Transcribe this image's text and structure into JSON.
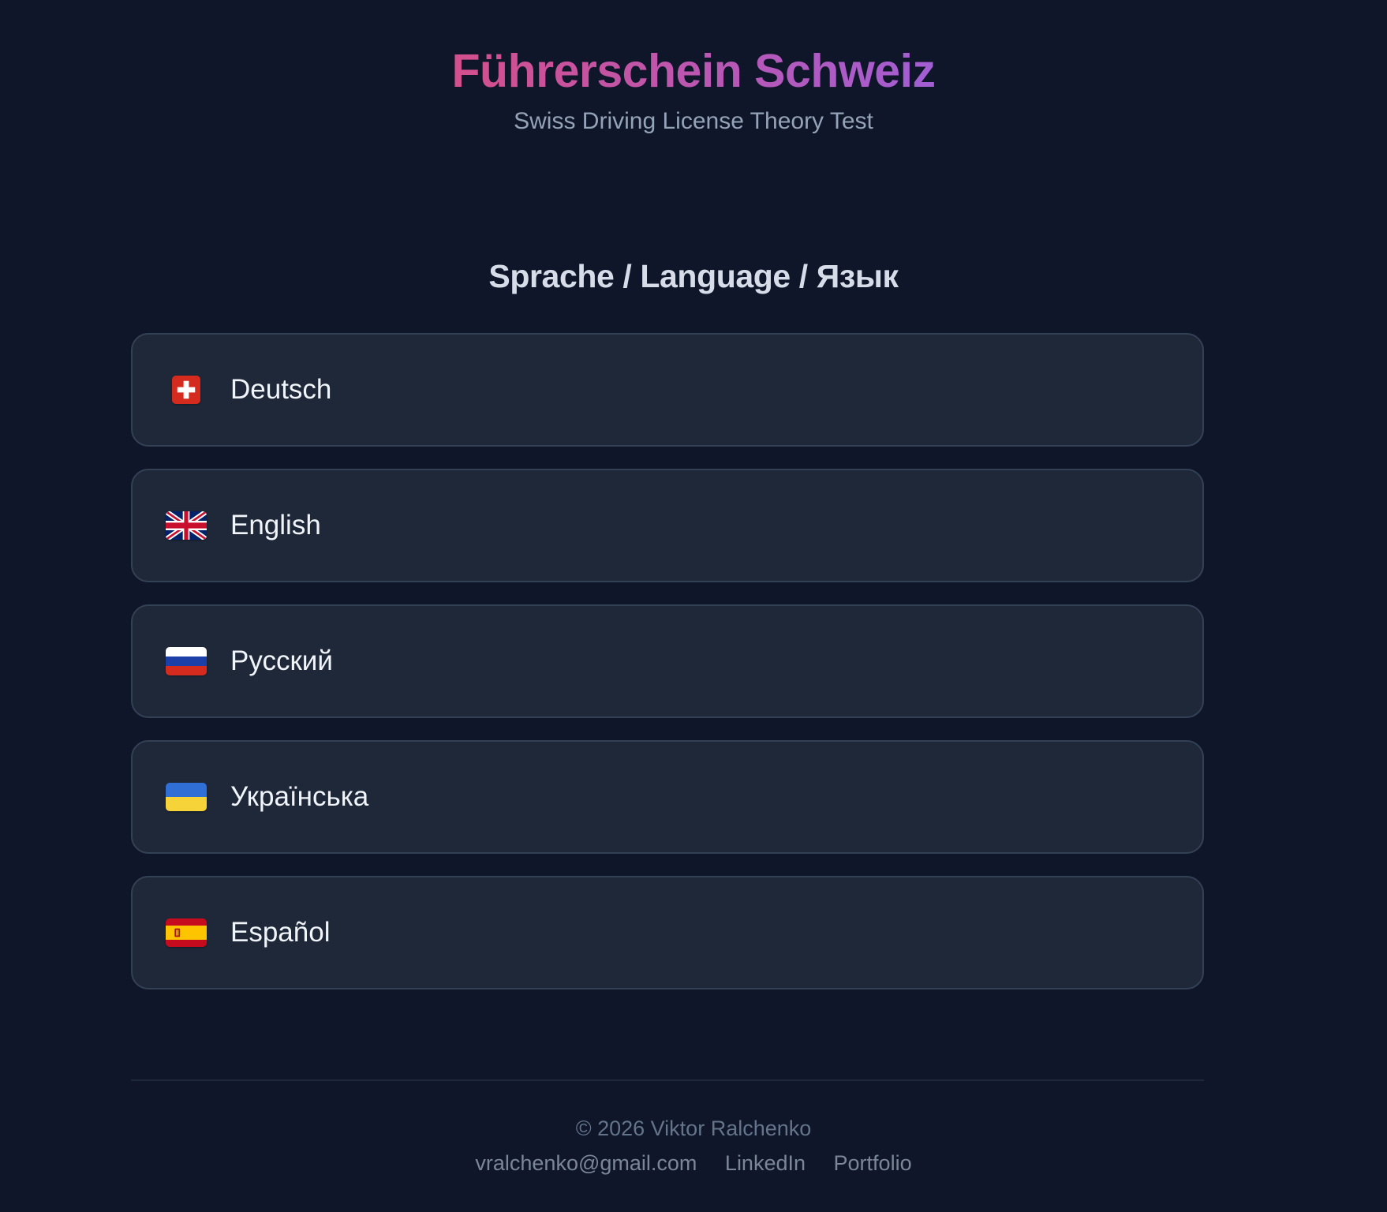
{
  "header": {
    "title": "Führerschein Schweiz",
    "subtitle": "Swiss Driving License Theory Test"
  },
  "language_section": {
    "title": "Sprache / Language / Язык",
    "options": [
      {
        "label": "Deutsch",
        "flag_icon": "switzerland-flag-icon"
      },
      {
        "label": "English",
        "flag_icon": "united-kingdom-flag-icon"
      },
      {
        "label": "Русский",
        "flag_icon": "russia-flag-icon"
      },
      {
        "label": "Українська",
        "flag_icon": "ukraine-flag-icon"
      },
      {
        "label": "Español",
        "flag_icon": "spain-flag-icon"
      }
    ]
  },
  "footer": {
    "copyright": "© 2026 Viktor Ralchenko",
    "links": [
      {
        "label": "vralchenko@gmail.com"
      },
      {
        "label": "LinkedIn"
      },
      {
        "label": "Portfolio"
      }
    ]
  },
  "colors": {
    "background": "#0f1629",
    "card": "#1e2839",
    "title_gradient_start": "#d44f8c",
    "title_gradient_end": "#a35ed4"
  }
}
